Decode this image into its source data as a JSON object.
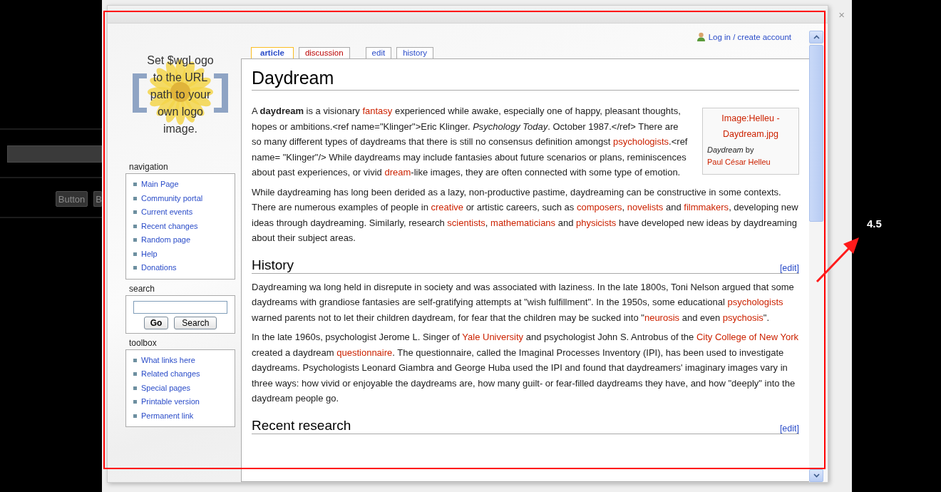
{
  "background": {
    "buttons": [
      "Button",
      "B"
    ]
  },
  "dialog": {
    "close": "×"
  },
  "wiki": {
    "logo_text": "Set $wgLogo to the URL path to your own logo image.",
    "login": "Log in / create account",
    "tabs": [
      {
        "label": "article",
        "selected": true,
        "new": false
      },
      {
        "label": "discussion",
        "selected": false,
        "new": true
      },
      {
        "label": "edit",
        "selected": false,
        "new": false
      },
      {
        "label": "history",
        "selected": false,
        "new": false
      }
    ],
    "sidebar": [
      {
        "kind": "links",
        "title": "navigation",
        "items": [
          "Main Page",
          "Community portal",
          "Current events",
          "Recent changes",
          "Random page",
          "Help",
          "Donations"
        ]
      },
      {
        "kind": "search",
        "title": "search",
        "buttons": [
          "Go",
          "Search"
        ]
      },
      {
        "kind": "links",
        "title": "toolbox",
        "items": [
          "What links here",
          "Related changes",
          "Special pages",
          "Printable version",
          "Permanent link"
        ]
      }
    ],
    "title": "Daydream",
    "image_box": {
      "link": "Image:Helleu - Daydream.jpg",
      "caption": [
        {
          "kind": "italic",
          "text": "Daydream"
        },
        {
          "kind": "text",
          "text": " by "
        },
        {
          "kind": "link",
          "text": "Paul César Helleu"
        }
      ]
    },
    "intro": [
      [
        {
          "kind": "text",
          "text": "A "
        },
        {
          "kind": "bold",
          "text": "daydream"
        },
        {
          "kind": "text",
          "text": " is a visionary "
        },
        {
          "kind": "link",
          "text": "fantasy"
        },
        {
          "kind": "text",
          "text": " experienced while awake, especially one of happy, pleasant thoughts, hopes or ambitions.<ref name=\"Klinger\">Eric Klinger. "
        },
        {
          "kind": "italic",
          "text": "Psychology Today"
        },
        {
          "kind": "text",
          "text": ". October 1987.</ref> There are so many different types of daydreams that there is still no consensus definition amongst "
        },
        {
          "kind": "link",
          "text": "psychologists"
        },
        {
          "kind": "text",
          "text": ".<ref name= \"Klinger\"/> While daydreams may include fantasies about future scenarios or plans, reminiscences about past experiences, or vivid "
        },
        {
          "kind": "link",
          "text": "dream"
        },
        {
          "kind": "text",
          "text": "-like images, they are often connected with some type of emotion."
        }
      ],
      [
        {
          "kind": "text",
          "text": "While daydreaming has long been derided as a lazy, non-productive pastime, daydreaming can be constructive in some contexts. There are numerous examples of people in "
        },
        {
          "kind": "link",
          "text": "creative"
        },
        {
          "kind": "text",
          "text": " or artistic careers, such as "
        },
        {
          "kind": "link",
          "text": "composers"
        },
        {
          "kind": "text",
          "text": ", "
        },
        {
          "kind": "link",
          "text": "novelists"
        },
        {
          "kind": "text",
          "text": " and "
        },
        {
          "kind": "link",
          "text": "filmmakers"
        },
        {
          "kind": "text",
          "text": ", developing new ideas through daydreaming. Similarly, research "
        },
        {
          "kind": "link",
          "text": "scientists"
        },
        {
          "kind": "text",
          "text": ", "
        },
        {
          "kind": "link",
          "text": "mathematicians"
        },
        {
          "kind": "text",
          "text": " and "
        },
        {
          "kind": "link",
          "text": "physicists"
        },
        {
          "kind": "text",
          "text": " have developed new ideas by daydreaming about their subject areas."
        }
      ]
    ],
    "sections": [
      {
        "heading": "History",
        "edit": "[edit]",
        "paragraphs": [
          [
            {
              "kind": "text",
              "text": "Daydreaming wa long held in disrepute in society and was associated with laziness. In the late 1800s, Toni Nelson argued that some daydreams with grandiose fantasies are self-gratifying attempts at \"wish fulfillment\". In the 1950s, some educational "
            },
            {
              "kind": "link",
              "text": "psychologists"
            },
            {
              "kind": "text",
              "text": " warned parents not to let their children daydream, for fear that the children may be sucked into \""
            },
            {
              "kind": "link",
              "text": "neurosis"
            },
            {
              "kind": "text",
              "text": " and even "
            },
            {
              "kind": "link",
              "text": "psychosis"
            },
            {
              "kind": "text",
              "text": "\"."
            }
          ],
          [
            {
              "kind": "text",
              "text": "In the late 1960s, psychologist Jerome L. Singer of "
            },
            {
              "kind": "link",
              "text": "Yale University"
            },
            {
              "kind": "text",
              "text": " and psychologist John S. Antrobus of the "
            },
            {
              "kind": "link",
              "text": "City College of New York"
            },
            {
              "kind": "text",
              "text": " created a daydream "
            },
            {
              "kind": "link",
              "text": "questionnaire"
            },
            {
              "kind": "text",
              "text": ". The questionnaire, called the Imaginal Processes Inventory (IPI), has been used to investigate daydreams. Psychologists Leonard Giambra and George Huba used the IPI and found that daydreamers' imaginary images vary in three ways: how vivid or enjoyable the daydreams are, how many guilt- or fear-filled daydreams they have, and how \"deeply\" into the daydream people go."
            }
          ]
        ]
      },
      {
        "heading": "Recent research",
        "edit": "[edit]"
      }
    ]
  },
  "annotation": {
    "label": "4.5"
  }
}
